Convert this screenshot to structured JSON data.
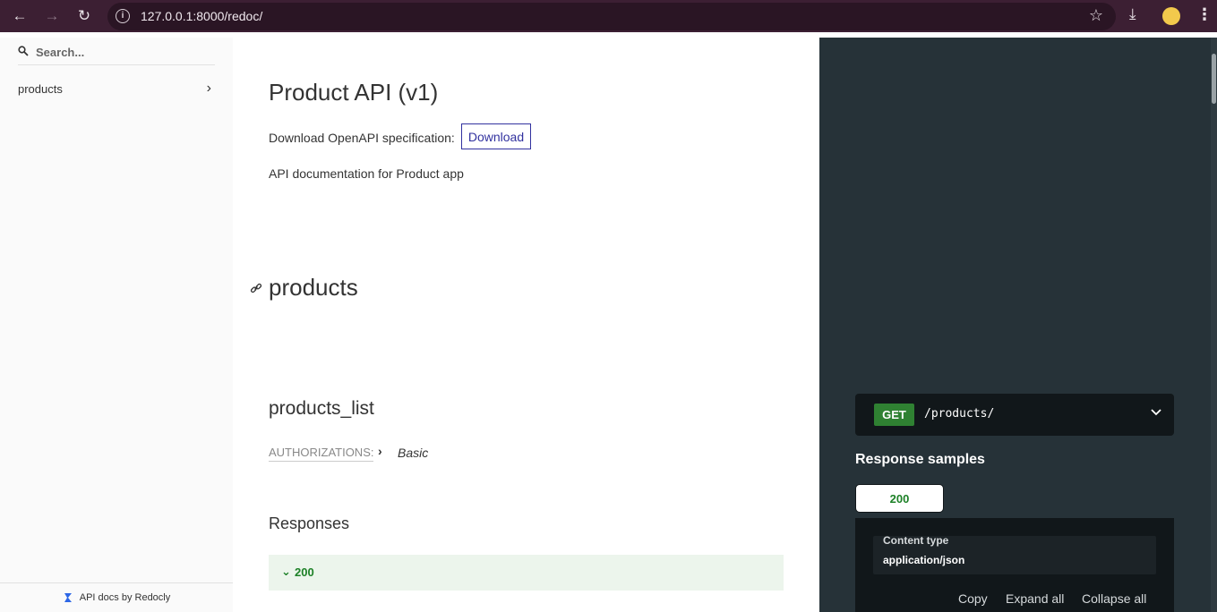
{
  "browser": {
    "url": "127.0.0.1:8000/redoc/",
    "icons": [
      "back-arrow-icon",
      "forward-arrow-icon",
      "reload-icon",
      "site-info-icon",
      "bookmark-star-icon",
      "download-icon",
      "profile-avatar",
      "menu-kebab-icon"
    ]
  },
  "sidebar": {
    "search_placeholder": "Search...",
    "items": [
      {
        "label": "products"
      }
    ],
    "footer": "API docs by Redocly"
  },
  "main": {
    "title": "Product API (v1)",
    "download_text": "Download OpenAPI specification:",
    "download_button": "Download",
    "description": "API documentation for Product app",
    "section_title": "products",
    "operation": {
      "title": "products_list",
      "auth_label": "AUTHORIZATIONS:",
      "auth_value": "Basic"
    },
    "responses_title": "Responses",
    "response_code": "200"
  },
  "right_panel": {
    "method": "GET",
    "path": "/products/",
    "samples_title": "Response samples",
    "tab_label": "200",
    "content_type_label": "Content type",
    "content_type_value": "application/json",
    "actions": {
      "copy": "Copy",
      "expand": "Expand all",
      "collapse": "Collapse all"
    }
  },
  "colors": {
    "chrome_bg": "#3c1f33",
    "right_panel_bg": "#263238",
    "accent": "#32329f",
    "success": "#1d8127",
    "get_badge": "#2f8132"
  }
}
